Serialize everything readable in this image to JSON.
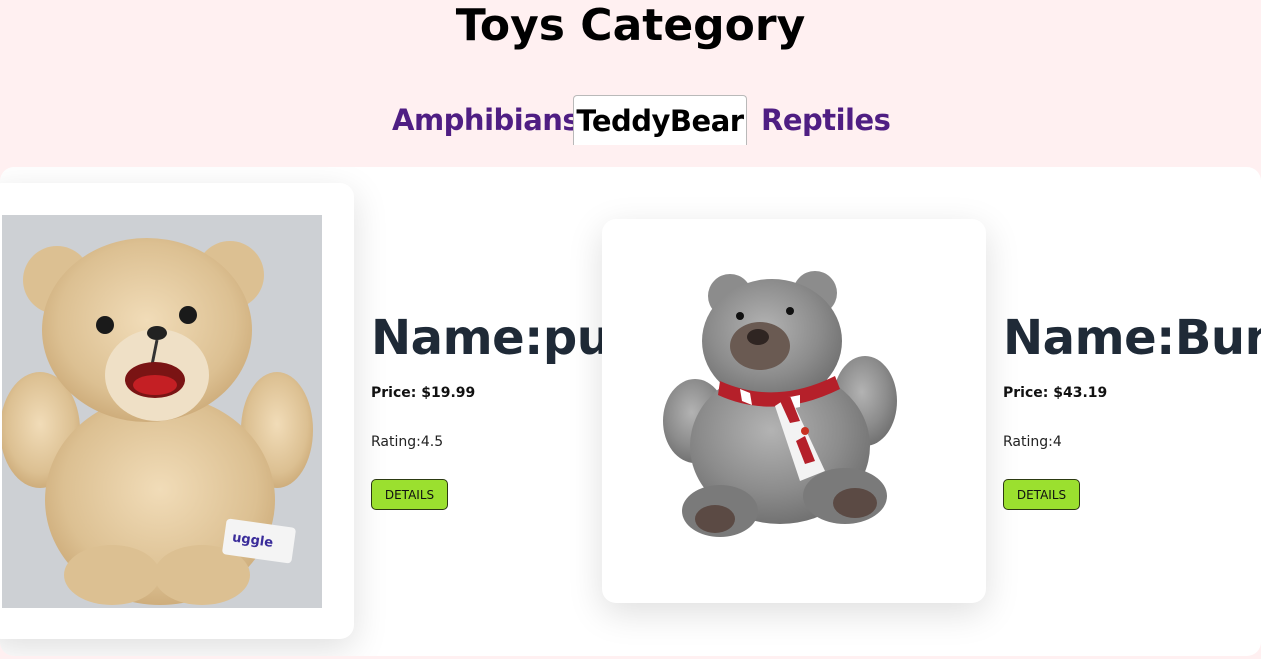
{
  "header": {
    "title": "Toys Category"
  },
  "tabs": [
    {
      "label": "Amphibians",
      "active": false
    },
    {
      "label": "TeddyBear",
      "active": true
    },
    {
      "label": "Reptiles",
      "active": false
    }
  ],
  "products": [
    {
      "name": "Name:pup",
      "price_label": "Price:",
      "price": "$19.99",
      "rating": "Rating:4.5",
      "button": "DETAILS"
    },
    {
      "name": "Name:Bunn",
      "price_label": "Price:",
      "price": "$43.19",
      "rating": "Rating:4",
      "button": "DETAILS"
    }
  ],
  "colors": {
    "page_bg": "#fff0f1",
    "tab_text": "#4f1e83",
    "details_button": "#9be02f"
  }
}
